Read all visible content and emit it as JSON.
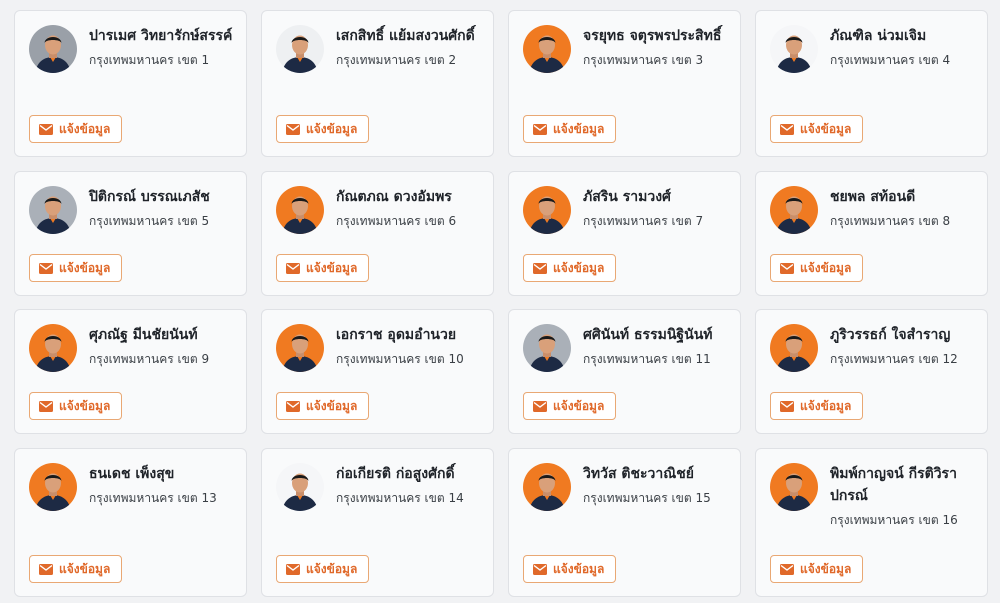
{
  "report_label": "แจ้งข้อมูล",
  "cards": [
    {
      "name": "ปารเมศ วิทยารักษ์สรรค์",
      "district": "กรุงเทพมหานคร เขต 1",
      "bg": "#9aa0a8"
    },
    {
      "name": "เสกสิทธิ์ แย้มสงวนศักดิ์",
      "district": "กรุงเทพมหานคร เขต 2",
      "bg": "#eef0f2"
    },
    {
      "name": "จรยุทธ จตุรพรประสิทธิ์",
      "district": "กรุงเทพมหานคร เขต 3",
      "bg": "#f07a21"
    },
    {
      "name": "ภัณฑิล น่วมเจิม",
      "district": "กรุงเทพมหานคร เขต 4",
      "bg": "#f5f6f8"
    },
    {
      "name": "ปิติกรณ์ บรรณเภสัช",
      "district": "กรุงเทพมหานคร เขต 5",
      "bg": "#aab0b8"
    },
    {
      "name": "กัณตภณ ดวงอัมพร",
      "district": "กรุงเทพมหานคร เขต 6",
      "bg": "#f07a21"
    },
    {
      "name": "ภัสริน รามวงศ์",
      "district": "กรุงเทพมหานคร เขต 7",
      "bg": "#f07a21"
    },
    {
      "name": "ชยพล สท้อนดี",
      "district": "กรุงเทพมหานคร เขต 8",
      "bg": "#f07a21"
    },
    {
      "name": "ศุภณัฐ มีนชัยนันท์",
      "district": "กรุงเทพมหานคร เขต 9",
      "bg": "#f07a21"
    },
    {
      "name": "เอกราช อุดมอำนวย",
      "district": "กรุงเทพมหานคร เขต 10",
      "bg": "#f07a21"
    },
    {
      "name": "ศศินันท์ ธรรมนิฐินันท์",
      "district": "กรุงเทพมหานคร เขต 11",
      "bg": "#aab0b8"
    },
    {
      "name": "ภูริวรรธก์ ใจสำราญ",
      "district": "กรุงเทพมหานคร เขต 12",
      "bg": "#f07a21"
    },
    {
      "name": "ธนเดช เพ็งสุข",
      "district": "กรุงเทพมหานคร เขต 13",
      "bg": "#f07a21"
    },
    {
      "name": "ก่อเกียรติ ก่อสูงศักดิ์",
      "district": "กรุงเทพมหานคร เขต 14",
      "bg": "#f5f6f8"
    },
    {
      "name": "วิทวัส ติชะวาณิชย์",
      "district": "กรุงเทพมหานคร เขต 15",
      "bg": "#f07a21"
    },
    {
      "name": "พิมพ์กาญจน์ กีรติวิราปกรณ์",
      "district": "กรุงเทพมหานคร เขต 16",
      "bg": "#f07a21"
    }
  ]
}
